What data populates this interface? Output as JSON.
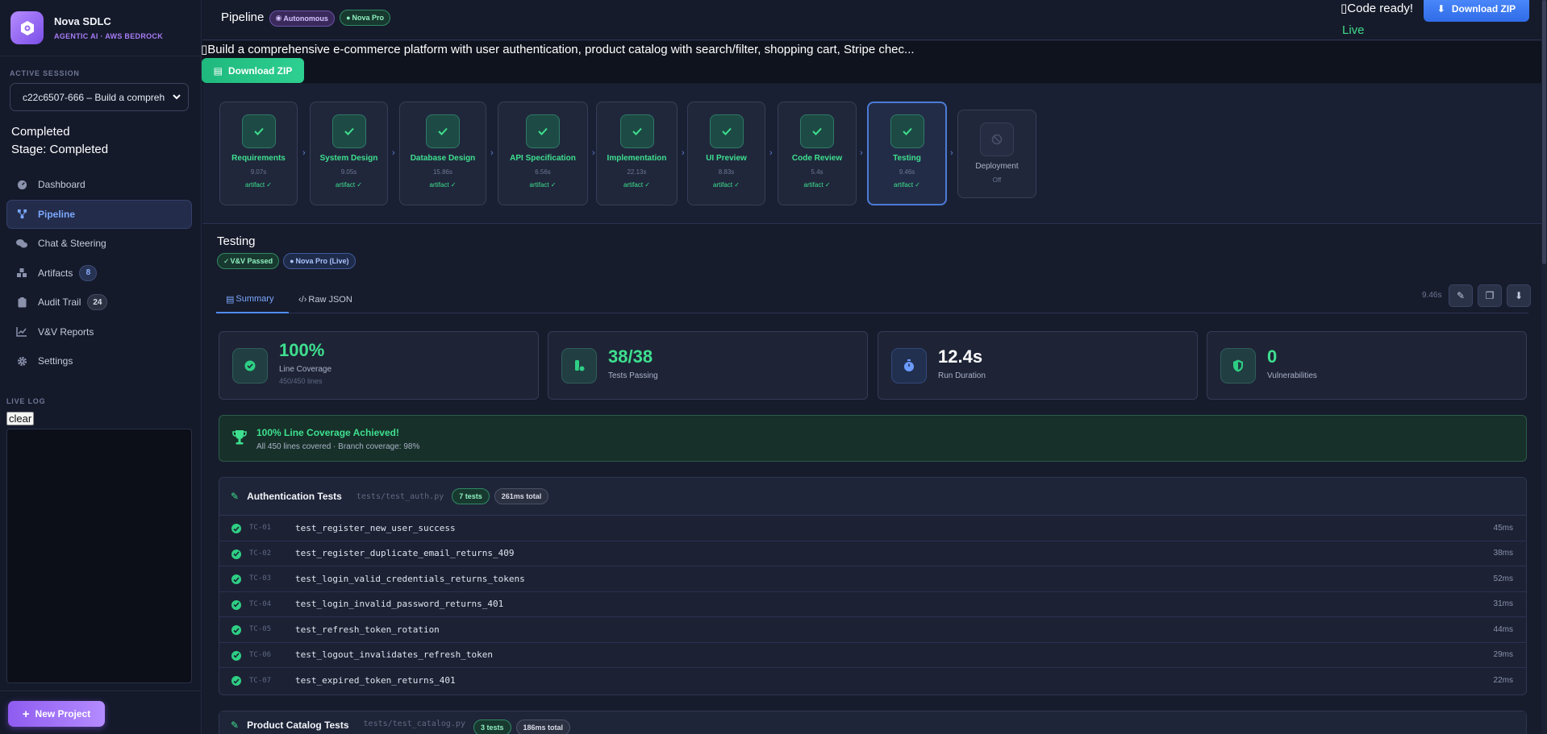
{
  "brand": {
    "title": "Nova SDLC",
    "subtitle": "AGENTIC AI · AWS BEDROCK"
  },
  "session": {
    "label": "ACTIVE SESSION",
    "selected": "c22c6507-666 – Build a compreh"
  },
  "status": {
    "line1": "Completed",
    "line2": "Stage: Completed"
  },
  "nav": [
    {
      "label": "Dashboard",
      "icon": "dashboard-icon"
    },
    {
      "label": "Pipeline",
      "icon": "pipeline-icon"
    },
    {
      "label": "Chat & Steering",
      "icon": "chat-icon"
    },
    {
      "label": "Artifacts",
      "icon": "artifacts-icon",
      "badge": "8"
    },
    {
      "label": "Audit Trail",
      "icon": "clipboard-icon",
      "badge": "24"
    },
    {
      "label": "V&V Reports",
      "icon": "chart-line-icon"
    },
    {
      "label": "Settings",
      "icon": "gear-icon"
    }
  ],
  "live_log": {
    "label": "LIVE LOG",
    "clear": "clear"
  },
  "new_project": "New Project",
  "topbar": {
    "title": "Pipeline",
    "pill_autonomous": "Autonomous",
    "pill_model": "Nova Pro",
    "code_ready": "Code ready!",
    "live": "Live",
    "download": "Download ZIP"
  },
  "prompt": {
    "text": "Build a comprehensive e-commerce platform with user authentication, product catalog with search/filter, shopping cart, Stripe chec...",
    "download": "Download ZIP"
  },
  "stages": [
    {
      "name": "Requirements",
      "time": "9.07s",
      "artifact": "artifact ✓"
    },
    {
      "name": "System Design",
      "time": "9.05s",
      "artifact": "artifact ✓"
    },
    {
      "name": "Database Design",
      "time": "15.86s",
      "artifact": "artifact ✓"
    },
    {
      "name": "API Specification",
      "time": "6.56s",
      "artifact": "artifact ✓"
    },
    {
      "name": "Implementation",
      "time": "22.13s",
      "artifact": "artifact ✓"
    },
    {
      "name": "UI Preview",
      "time": "8.83s",
      "artifact": "artifact ✓"
    },
    {
      "name": "Code Review",
      "time": "5.4s",
      "artifact": "artifact ✓"
    },
    {
      "name": "Testing",
      "time": "9.46s",
      "artifact": "artifact ✓"
    },
    {
      "name": "Deployment",
      "time": "Off"
    }
  ],
  "detail": {
    "title": "Testing",
    "badge_vv": "V&V Passed",
    "badge_model": "Nova Pro (Live)",
    "tab_summary": "Summary",
    "tab_json": "Raw JSON",
    "time": "9.46s"
  },
  "stats": [
    {
      "value": "100%",
      "label": "Line Coverage",
      "sub": "450/450 lines",
      "color": "#3ee08f",
      "icon": "check-circle-icon"
    },
    {
      "value": "38/38",
      "label": "Tests Passing",
      "color": "#3ee08f",
      "icon": "flask-icon"
    },
    {
      "value": "12.4s",
      "label": "Run Duration",
      "color": "#ffffff",
      "icon": "stopwatch-icon"
    },
    {
      "value": "0",
      "label": "Vulnerabilities",
      "color": "#3ee08f",
      "icon": "shield-icon"
    }
  ],
  "banner": {
    "title": "100% Line Coverage Achieved!",
    "sub": "All 450 lines covered · Branch coverage: 98%"
  },
  "test_groups": [
    {
      "name": "Authentication Tests",
      "file": "tests/test_auth.py",
      "count": "7 tests",
      "total": "261ms total",
      "tests": [
        {
          "id": "TC-01",
          "name": "test_register_new_user_success",
          "ms": "45ms"
        },
        {
          "id": "TC-02",
          "name": "test_register_duplicate_email_returns_409",
          "ms": "38ms"
        },
        {
          "id": "TC-03",
          "name": "test_login_valid_credentials_returns_tokens",
          "ms": "52ms"
        },
        {
          "id": "TC-04",
          "name": "test_login_invalid_password_returns_401",
          "ms": "31ms"
        },
        {
          "id": "TC-05",
          "name": "test_refresh_token_rotation",
          "ms": "44ms"
        },
        {
          "id": "TC-06",
          "name": "test_logout_invalidates_refresh_token",
          "ms": "29ms"
        },
        {
          "id": "TC-07",
          "name": "test_expired_token_returns_401",
          "ms": "22ms"
        }
      ]
    },
    {
      "name": "Product Catalog Tests",
      "file": "tests/test_catalog.py",
      "count": "3 tests",
      "total": "186ms total"
    }
  ],
  "colors": {
    "accent": "#4f8dff",
    "success": "#3ee08f",
    "brand": "#8f5cf0"
  }
}
